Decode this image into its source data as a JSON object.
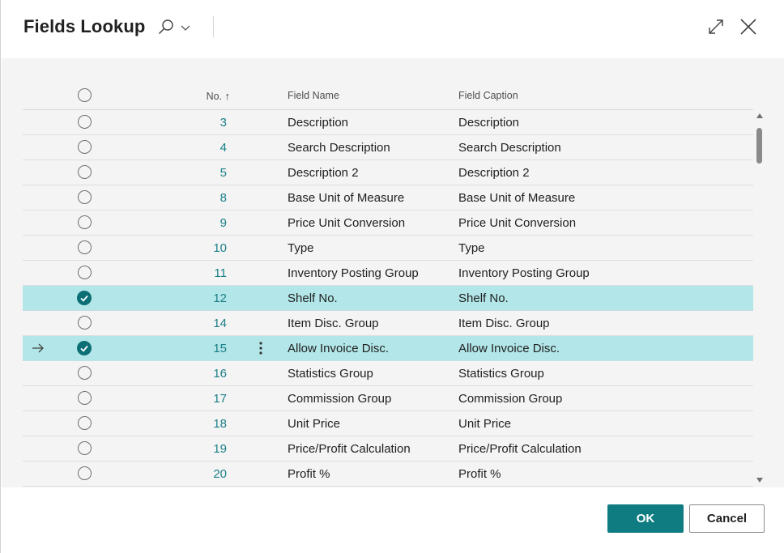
{
  "dialog": {
    "title": "Fields Lookup",
    "ok_label": "OK",
    "cancel_label": "Cancel"
  },
  "icons": {
    "search": "search-icon",
    "dropdown": "chevron-down-icon",
    "expand": "expand-icon",
    "close": "close-icon",
    "current_row": "arrow-right-icon",
    "row_menu": "more-vertical-icon",
    "sort": "sort-ascending-icon"
  },
  "colors": {
    "accent": "#0e7c80",
    "selected_row": "#b2e6e8",
    "link_number": "#1a7f86"
  },
  "grid": {
    "columns": {
      "no": "No.",
      "sort_indicator": "↑",
      "field_name": "Field Name",
      "field_caption": "Field Caption"
    },
    "rows": [
      {
        "no": "3",
        "field_name": "Description",
        "field_caption": "Description",
        "selected": false,
        "current": false
      },
      {
        "no": "4",
        "field_name": "Search Description",
        "field_caption": "Search Description",
        "selected": false,
        "current": false
      },
      {
        "no": "5",
        "field_name": "Description 2",
        "field_caption": "Description 2",
        "selected": false,
        "current": false
      },
      {
        "no": "8",
        "field_name": "Base Unit of Measure",
        "field_caption": "Base Unit of Measure",
        "selected": false,
        "current": false
      },
      {
        "no": "9",
        "field_name": "Price Unit Conversion",
        "field_caption": "Price Unit Conversion",
        "selected": false,
        "current": false
      },
      {
        "no": "10",
        "field_name": "Type",
        "field_caption": "Type",
        "selected": false,
        "current": false
      },
      {
        "no": "11",
        "field_name": "Inventory Posting Group",
        "field_caption": "Inventory Posting Group",
        "selected": false,
        "current": false
      },
      {
        "no": "12",
        "field_name": "Shelf No.",
        "field_caption": "Shelf No.",
        "selected": true,
        "current": false
      },
      {
        "no": "14",
        "field_name": "Item Disc. Group",
        "field_caption": "Item Disc. Group",
        "selected": false,
        "current": false
      },
      {
        "no": "15",
        "field_name": "Allow Invoice Disc.",
        "field_caption": "Allow Invoice Disc.",
        "selected": true,
        "current": true
      },
      {
        "no": "16",
        "field_name": "Statistics Group",
        "field_caption": "Statistics Group",
        "selected": false,
        "current": false
      },
      {
        "no": "17",
        "field_name": "Commission Group",
        "field_caption": "Commission Group",
        "selected": false,
        "current": false
      },
      {
        "no": "18",
        "field_name": "Unit Price",
        "field_caption": "Unit Price",
        "selected": false,
        "current": false
      },
      {
        "no": "19",
        "field_name": "Price/Profit Calculation",
        "field_caption": "Price/Profit Calculation",
        "selected": false,
        "current": false
      },
      {
        "no": "20",
        "field_name": "Profit %",
        "field_caption": "Profit %",
        "selected": false,
        "current": false
      }
    ]
  }
}
